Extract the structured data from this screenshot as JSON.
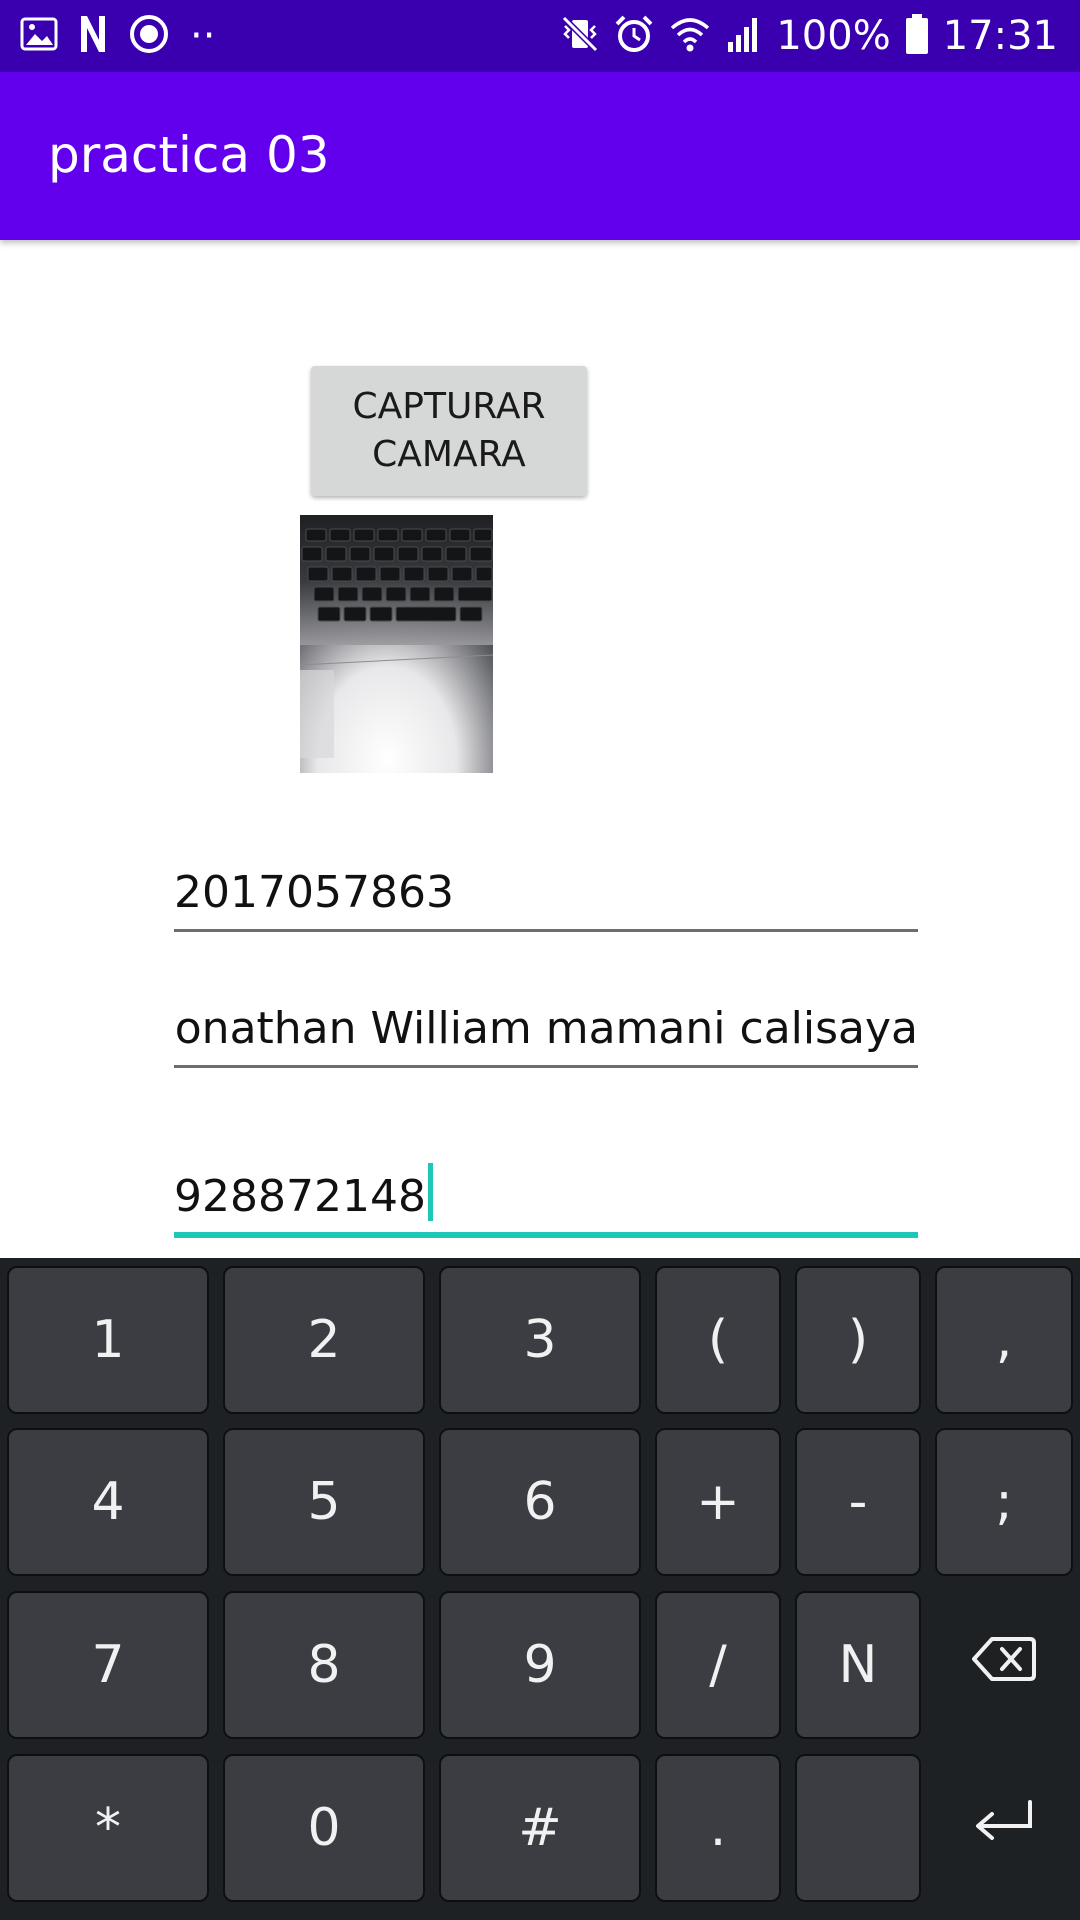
{
  "status_bar": {
    "left_icons": [
      "image-icon",
      "n-notification-icon",
      "record-icon",
      "more-dots-icon"
    ],
    "more_dots": "··",
    "battery_percent": "100%",
    "time": "17:31",
    "right_icons": [
      "vibrate-mute-icon",
      "alarm-icon",
      "wifi-icon",
      "signal-icon",
      "battery-icon"
    ]
  },
  "app_bar": {
    "title": "practica 03"
  },
  "capture_button": {
    "line1": "CAPTURAR",
    "line2": "CAMARA"
  },
  "photo": {
    "description_icon": "captured-photo"
  },
  "fields": {
    "code": "2017057863",
    "name": "yonathan William mamani calisaya",
    "phone": "928872148"
  },
  "keyboard": {
    "row1": [
      "1",
      "2",
      "3",
      "(",
      ")",
      ","
    ],
    "row2": [
      "4",
      "5",
      "6",
      "+",
      "-",
      ";"
    ],
    "row3": [
      "7",
      "8",
      "9",
      "/",
      "N"
    ],
    "row4": [
      "*",
      "0",
      "#",
      ".",
      ""
    ],
    "backspace_icon": "backspace-icon",
    "enter_icon": "enter-icon"
  },
  "colors": {
    "status_bar": "#3a00b0",
    "app_bar": "#6200ee",
    "accent": "#1ec7b8",
    "keyboard_bg": "#1e2124",
    "key_bg": "#3b3d42"
  }
}
